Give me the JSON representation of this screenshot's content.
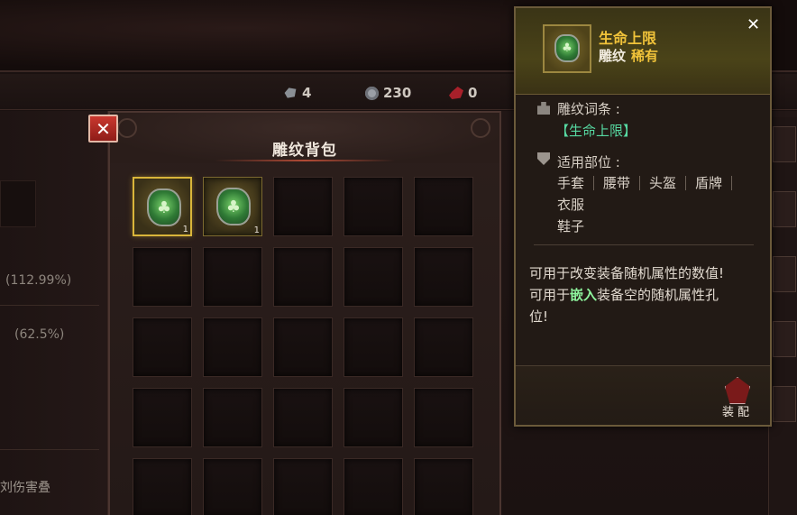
{
  "currency": [
    {
      "icon": "stone-icon",
      "value": "4"
    },
    {
      "icon": "gem-icon",
      "value": "230"
    },
    {
      "icon": "blood-icon",
      "value": "0"
    }
  ],
  "left_panel": {
    "stat1": "(112.99%)",
    "stat2": "(62.5%)",
    "bottom_text": "刘伤害叠"
  },
  "bag": {
    "title": "雕纹背包",
    "close_label": "✕",
    "items": [
      {
        "rune_glyph": "♣",
        "count": "1",
        "selected": true
      },
      {
        "rune_glyph": "♣",
        "count": "1",
        "selected": false
      }
    ]
  },
  "tooltip": {
    "close_label": "✕",
    "name": "生命上限",
    "type": "雕纹",
    "rarity": "稀有",
    "affix_label": "雕纹词条 :",
    "affix_value": "【生命上限】",
    "slot_label": "适用部位 :",
    "slots_row1": [
      "手套",
      "腰带",
      "头盔",
      "盾牌"
    ],
    "slots_row2": "衣服",
    "slots_row3": "鞋子",
    "desc_line1": "可用于改变装备随机属性的数值!",
    "desc_line2_pre": "可用于",
    "desc_line2_hl": "嵌入",
    "desc_line2_post": "装备空的随机属性孔",
    "desc_line3": "位!",
    "equip_label": "装配"
  },
  "colors": {
    "rarity": "#f1c33a",
    "affix": "#57d9a2",
    "highlight": "#8ef59d",
    "close_red": "#c9382f"
  }
}
